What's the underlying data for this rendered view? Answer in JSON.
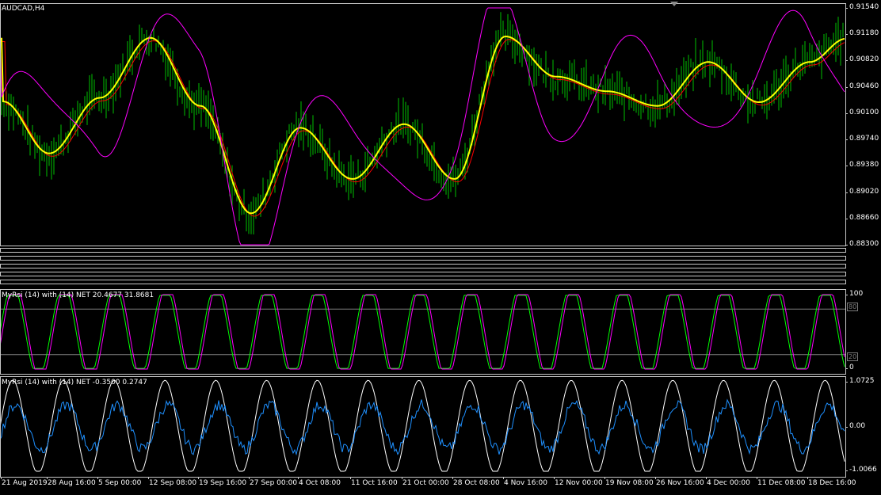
{
  "main": {
    "title": "AUDCAD,H4",
    "price_ticks": [
      "0.91540",
      "0.91180",
      "0.90820",
      "0.90460",
      "0.90100",
      "0.89740",
      "0.89380",
      "0.89020",
      "0.88660",
      "0.88300"
    ],
    "price_range": [
      0.883,
      0.9154
    ],
    "colors": {
      "bars": "#00c000",
      "ma_fast": "#ffff00",
      "ma_slow": "#ff0000",
      "envelope": "#ff00ff"
    }
  },
  "empty_indicator_windows": 5,
  "rsi1": {
    "label": "MyRsi (14) with (14) NET 20.4677 31.8681",
    "ticks": [
      "100",
      "0"
    ],
    "levels": [
      "80",
      "20"
    ],
    "colors": {
      "line_a": "#00ff00",
      "line_b": "#ff00ff",
      "level": "#808080"
    }
  },
  "rsi2": {
    "label": "MyRsi (14) with (14) NET -0.3500 0.2747",
    "ticks": [
      "1.0725",
      "0.00",
      "-1.0066"
    ],
    "colors": {
      "line_a": "#ffffff",
      "line_b": "#1e90ff"
    }
  },
  "time_ticks": [
    "21 Aug 2019",
    "28 Aug 16:00",
    "5 Sep 00:00",
    "12 Sep 08:00",
    "19 Sep 16:00",
    "27 Sep 00:00",
    "4 Oct 08:00",
    "11 Oct 16:00",
    "21 Oct 00:00",
    "28 Oct 08:00",
    "4 Nov 16:00",
    "12 Nov 00:00",
    "19 Nov 08:00",
    "26 Nov 16:00",
    "4 Dec 00:00",
    "11 Dec 08:00",
    "18 Dec 16:00"
  ],
  "chart_data": {
    "type": "line",
    "symbol": "AUDCAD",
    "timeframe": "H4",
    "x": [
      "21 Aug 2019",
      "28 Aug 16:00",
      "5 Sep 00:00",
      "12 Sep 08:00",
      "19 Sep 16:00",
      "27 Sep 00:00",
      "4 Oct 08:00",
      "11 Oct 16:00",
      "21 Oct 00:00",
      "28 Oct 08:00",
      "4 Nov 16:00",
      "12 Nov 00:00",
      "19 Nov 08:00",
      "26 Nov 16:00",
      "4 Dec 00:00",
      "11 Dec 08:00",
      "18 Dec 16:00"
    ],
    "series": [
      {
        "name": "",
        "values": [
          0.9026,
          0.8955,
          0.9031,
          0.9113,
          0.902,
          0.8873,
          0.899,
          0.892,
          0.8995,
          0.892,
          0.9115,
          0.906,
          0.904,
          0.902,
          0.908,
          0.9025,
          0.908
        ]
      }
    ],
    "ylim": [
      0.883,
      0.9154
    ],
    "grid": false
  }
}
